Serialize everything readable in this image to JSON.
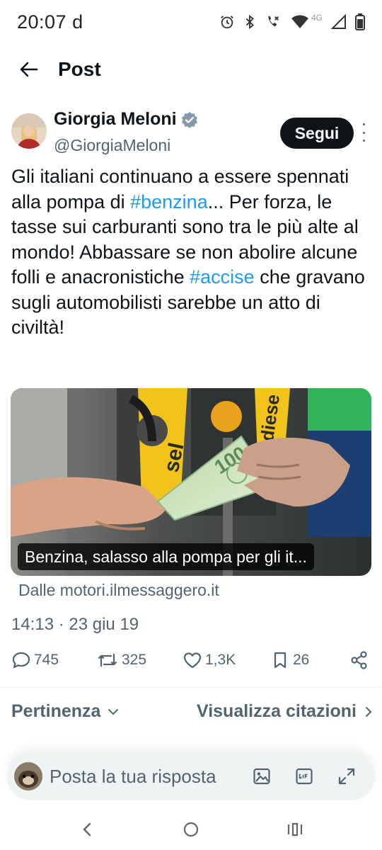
{
  "status_bar": {
    "time": "20:07",
    "carrier_mark": "d",
    "network": "4G"
  },
  "header": {
    "title": "Post"
  },
  "author": {
    "name": "Giorgia Meloni",
    "handle": "@GiorgiaMeloni",
    "follow_label": "Segui"
  },
  "tweet": {
    "segments": [
      "Gli italiani continuano a essere spennati alla pompa di ",
      "#benzina",
      "... Per forza, le tasse sui carburanti sono tra le più alte al mondo! Abbassare se non abolire alcune folli e anacronistiche ",
      "#accise",
      " che gravano sugli automobilisti sarebbe un atto di civiltà!"
    ]
  },
  "card": {
    "caption": "Benzina, salasso alla pompa per gli it...",
    "source": "Dalle motori.ilmessaggero.it",
    "photo_text": {
      "pump_left": "sel",
      "pump_right": "diese",
      "banknote": "100"
    }
  },
  "timestamp": "14:13 · 23 giu 19",
  "actions": {
    "replies": "745",
    "reposts": "325",
    "likes": "1,3K",
    "bookmarks": "26"
  },
  "sort": {
    "left_label": "Pertinenza",
    "right_label": "Visualizza citazioni"
  },
  "reply": {
    "placeholder": "Posta la tua risposta"
  },
  "colors": {
    "accent": "#1d9bf0",
    "text": "#0f1419",
    "muted": "#536471",
    "verified": "#829aab"
  }
}
